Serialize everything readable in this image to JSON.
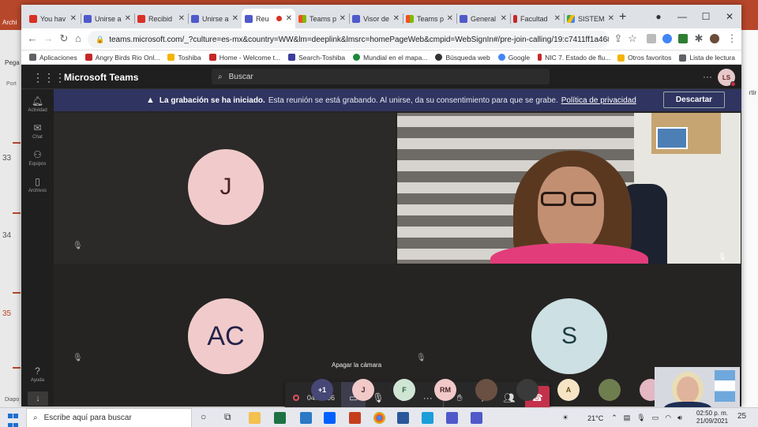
{
  "ppt": {
    "slide_numbers": [
      "33",
      "34",
      "35"
    ],
    "pega_label": "Pega",
    "port_label": "Port",
    "diapo_label": "Diapo",
    "archi_label": "Archi",
    "right_label": "rtir"
  },
  "browser": {
    "tabs": [
      {
        "label": "You hav",
        "fav_color": "#d93025"
      },
      {
        "label": "Unirse a",
        "fav_color": "#5059c9"
      },
      {
        "label": "Recibid",
        "fav_color": "#d93025"
      },
      {
        "label": "Unirse a",
        "fav_color": "#5059c9"
      },
      {
        "label": "Reu",
        "fav_color": "#5059c9",
        "active": true
      },
      {
        "label": "Teams p",
        "fav_color": "#f4b400"
      },
      {
        "label": "Visor de",
        "fav_color": "#5059c9"
      },
      {
        "label": "Teams p",
        "fav_color": "#f4b400"
      },
      {
        "label": "General",
        "fav_color": "#5059c9"
      },
      {
        "label": "Facultad",
        "fav_color": "#c62828"
      },
      {
        "label": "SISTEM",
        "fav_color": "#34a853"
      }
    ],
    "new_tab": "+",
    "url": "teams.microsoft.com/_?culture=es-mx&country=WW&lm=deeplink&lmsrc=homePageWeb&cmpid=WebSignIn#/pre-join-calling/19:c7411ff1a4684735a33bf561e...",
    "bookmarks": [
      {
        "label": "Aplicaciones",
        "color": "#5f6368"
      },
      {
        "label": "Angry Birds Rio Onl...",
        "color": "#c62828"
      },
      {
        "label": "Toshiba",
        "color": "#f4b400"
      },
      {
        "label": "Home - Welcome t...",
        "color": "#c62828"
      },
      {
        "label": "Search-Toshiba",
        "color": "#3c3c9c"
      },
      {
        "label": "Mundial en el mapa...",
        "color": "#1b8a3a"
      },
      {
        "label": "Búsqueda web",
        "color": "#333333"
      },
      {
        "label": "Google",
        "color": "#4285f4"
      },
      {
        "label": "NIC 7. Estado de flu...",
        "color": "#c62828"
      }
    ],
    "bookmarks_right": [
      {
        "label": "Otros favoritos"
      },
      {
        "label": "Lista de lectura"
      }
    ]
  },
  "teams": {
    "title": "Microsoft Teams",
    "search_placeholder": "Buscar",
    "user_initials": "LS",
    "rail": [
      {
        "label": "Actividad",
        "icon": "bell-icon"
      },
      {
        "label": "Chat",
        "icon": "chat-icon"
      },
      {
        "label": "Equipos",
        "icon": "teams-icon"
      },
      {
        "label": "Archivos",
        "icon": "file-icon"
      },
      {
        "label": "Ayuda",
        "icon": "help-icon"
      }
    ],
    "banner": {
      "bold": "La grabación se ha iniciado.",
      "text": "Esta reunión se está grabando. Al unirse, da su consentimiento para que se grabe.",
      "link": "Política de privacidad",
      "dismiss": "Descartar"
    },
    "participants": {
      "j": "J",
      "ac": "AC",
      "s": "S"
    },
    "controls": {
      "tooltip": "Apagar la cámara",
      "timer": "04:59:06"
    },
    "roster": [
      {
        "label": "+1",
        "bg": "#464775",
        "color": "#ffffff"
      },
      {
        "label": "J",
        "bg": "#f1c9c9",
        "color": "#6b2424"
      },
      {
        "label": "F",
        "bg": "#cfe6d5",
        "color": "#2f5d3b"
      },
      {
        "label": "RM",
        "bg": "#f1c9c9",
        "color": "#6b2424"
      },
      {
        "label": "",
        "bg": "#6a5042",
        "color": "#ffffff"
      },
      {
        "label": "",
        "bg": "#3a3a3a",
        "color": "#ffffff"
      },
      {
        "label": "A",
        "bg": "#f6e5c5",
        "color": "#6b5020"
      },
      {
        "label": "",
        "bg": "#6f7e4e",
        "color": "#ffffff"
      },
      {
        "label": "",
        "bg": "#e3b7c4",
        "color": "#ffffff"
      }
    ]
  },
  "taskbar": {
    "search_placeholder": "Escribe aquí para buscar",
    "weather": "21°C",
    "time": "02:50 p. m.",
    "date": "21/09/2021",
    "notifications": "25"
  }
}
